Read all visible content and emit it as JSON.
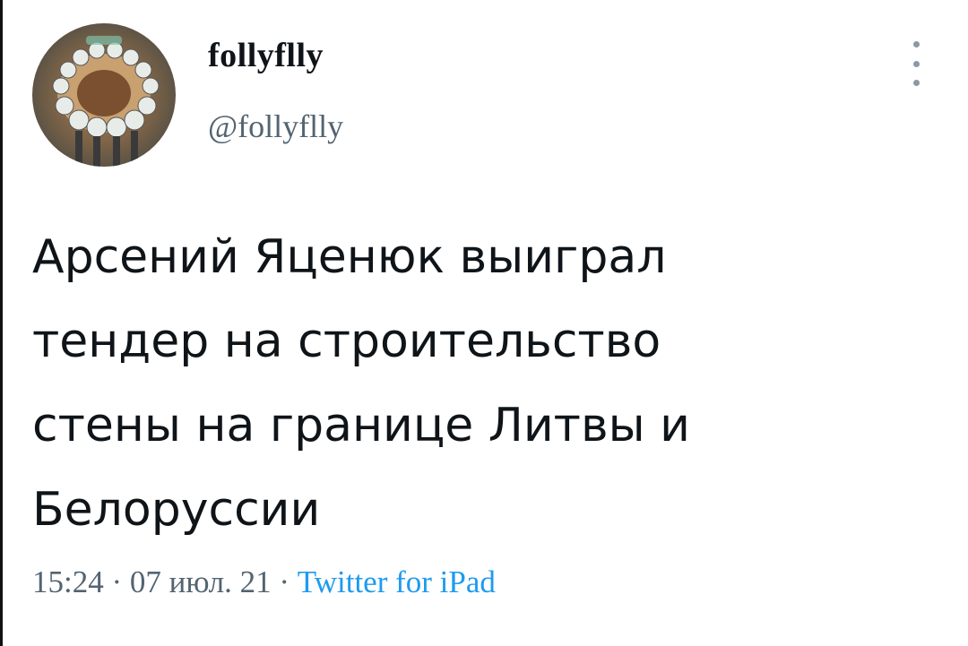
{
  "tweet": {
    "display_name": "follyflly",
    "handle": "@follyflly",
    "text_lines": [
      "Арсений Яценюк выиграл",
      "тендер на строительство",
      "стены на границе Литвы и",
      "Белоруссии"
    ],
    "time": "15:24",
    "separator": " · ",
    "date": "07 июл. 21",
    "source": "Twitter for iPad"
  },
  "colors": {
    "text": "#0f1419",
    "secondary": "#536471",
    "link": "#1d9bf0"
  },
  "icons": {
    "more": "more-vertical-icon"
  }
}
